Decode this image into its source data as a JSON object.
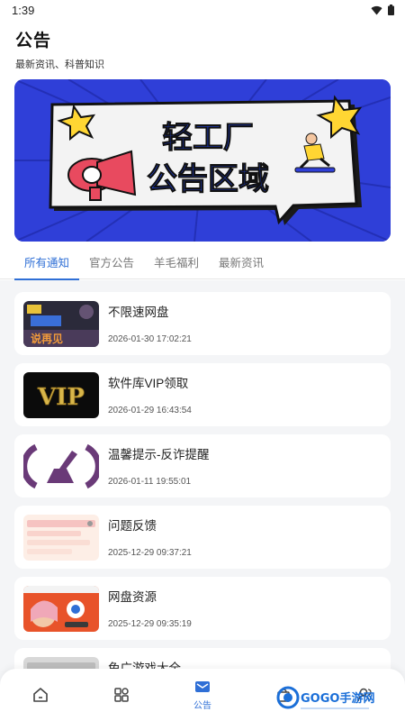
{
  "status_bar": {
    "time": "1:39"
  },
  "header": {
    "title": "公告",
    "subtitle": "最新资讯、科普知识"
  },
  "banner": {
    "line1": "轻工厂",
    "line2": "公告区域",
    "bg_color": "#2f3fd8",
    "accent": "#ffd633"
  },
  "tabs": [
    {
      "label": "所有通知",
      "active": true
    },
    {
      "label": "官方公告",
      "active": false
    },
    {
      "label": "羊毛福利",
      "active": false
    },
    {
      "label": "最新资讯",
      "active": false
    }
  ],
  "posts": [
    {
      "title": "不限速网盘",
      "date": "2026-01-30 17:02:21",
      "thumb_text": "说再见"
    },
    {
      "title": "软件库VIP领取",
      "date": "2026-01-29 16:43:54",
      "thumb_text": "VIP"
    },
    {
      "title": "温馨提示-反诈提醒",
      "date": "2026-01-11 19:55:01"
    },
    {
      "title": "问题反馈",
      "date": "2025-12-29 09:37:21"
    },
    {
      "title": "网盘资源",
      "date": "2025-12-29 09:35:19"
    },
    {
      "title": "免广游戏大全",
      "date": ""
    }
  ],
  "bottom_nav": {
    "items": [
      {
        "icon": "home-icon"
      },
      {
        "icon": "grid-icon"
      },
      {
        "icon": "announcement-icon",
        "label": "公告",
        "active": true
      },
      {
        "icon": "bag-icon"
      },
      {
        "icon": "user-icon"
      }
    ]
  },
  "watermark": {
    "text": "GOGO手游网"
  },
  "colors": {
    "accent": "#2f6fd6",
    "background": "#f4f5f7"
  }
}
